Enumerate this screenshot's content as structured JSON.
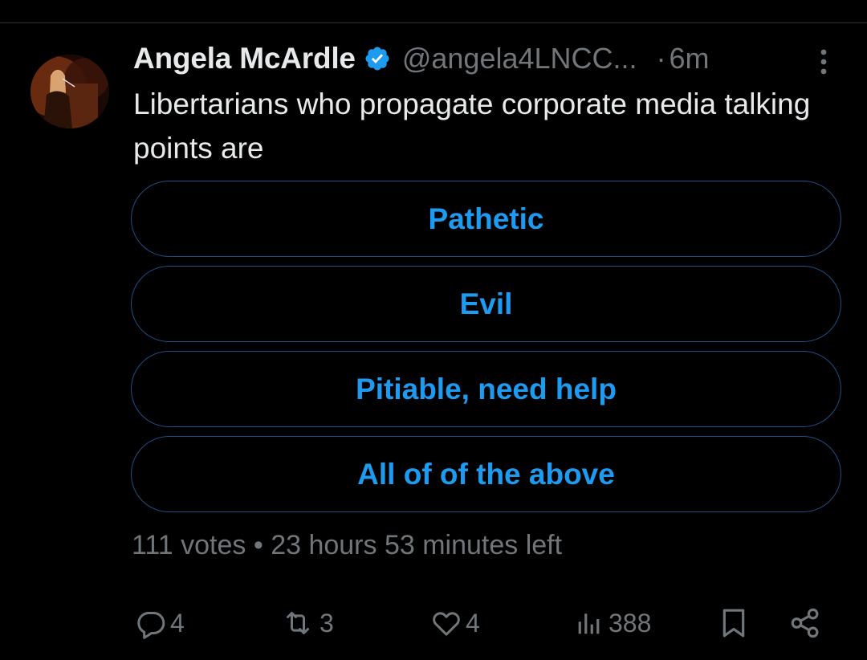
{
  "tweet": {
    "author_name": "Angela McArdle",
    "handle": "@angela4LNCC...",
    "separator": "·",
    "time_ago": "6m",
    "text": "Libertarians who propagate corporate media talking points are",
    "avatar_icon": "profile-photo",
    "verified_icon": "verified-badge-icon",
    "more_icon": "more-vertical-icon"
  },
  "poll": {
    "options": [
      {
        "label": "Pathetic"
      },
      {
        "label": "Evil"
      },
      {
        "label": "Pitiable, need help"
      },
      {
        "label": "All of of the above"
      }
    ],
    "meta": "111 votes • 23 hours 53 minutes left"
  },
  "actions": {
    "replies": "4",
    "reposts": "3",
    "likes": "4",
    "views": "388"
  },
  "colors": {
    "background": "#000000",
    "text_primary": "#e7e9ea",
    "text_secondary": "#71767b",
    "accent": "#1d9bf0",
    "poll_border": "#1d4f86"
  }
}
